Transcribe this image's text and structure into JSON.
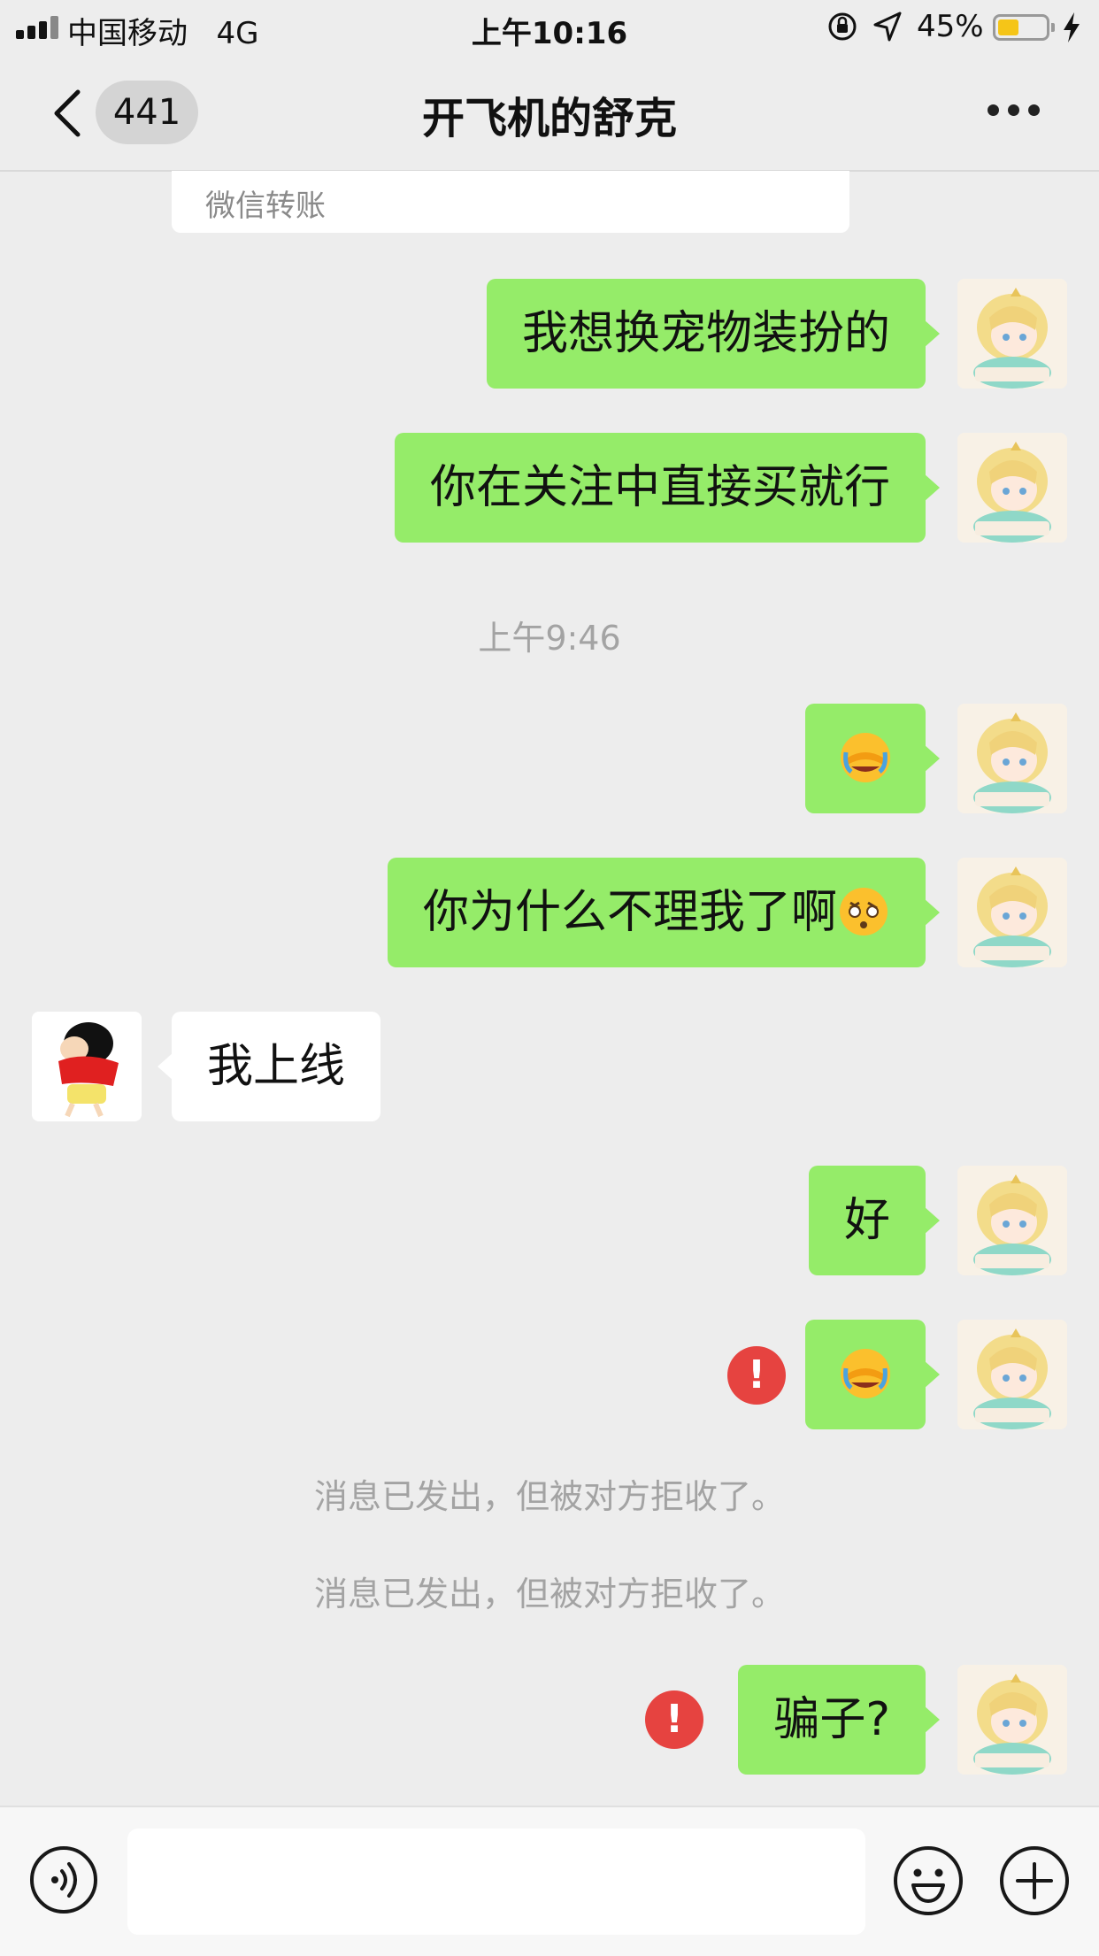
{
  "status_bar": {
    "carrier": "中国移动",
    "network": "4G",
    "time": "上午10:16",
    "battery_percent": "45%",
    "battery_level": 0.45,
    "battery_color": "#f5c518"
  },
  "nav": {
    "unread_count": "441",
    "title": "开飞机的舒克",
    "back_icon": "chevron-left-icon",
    "more_icon": "ellipsis-icon"
  },
  "transfer": {
    "label": "微信转账"
  },
  "messages": {
    "m1": {
      "sender": "self",
      "text": "我想换宠物装扮的"
    },
    "m2": {
      "sender": "self",
      "text": "你在关注中直接买就行"
    },
    "time1": "上午9:46",
    "m3": {
      "sender": "self",
      "emoji": "face-with-hand-over-eyes-crying-emoji"
    },
    "m4": {
      "sender": "self",
      "text": "你为什么不理我了啊",
      "emoji": "dizzy-face-emoji"
    },
    "m5": {
      "sender": "peer",
      "text": "我上线"
    },
    "m6": {
      "sender": "self",
      "text": "好"
    },
    "m7": {
      "sender": "self",
      "emoji": "face-with-hand-over-eyes-crying-emoji",
      "failed": true
    },
    "notice1": "消息已发出，但被对方拒收了。",
    "notice2": "消息已发出，但被对方拒收了。",
    "m8": {
      "sender": "self",
      "text": "骗子?",
      "failed": true
    },
    "error_symbol": "!"
  },
  "colors": {
    "self_bubble": "#95ec69",
    "peer_bubble": "#ffffff",
    "error": "#e64340",
    "background": "#ededed"
  },
  "input_bar": {
    "voice_icon": "voice-icon",
    "emoji_icon": "smiley-icon",
    "plus_icon": "plus-circle-icon"
  }
}
